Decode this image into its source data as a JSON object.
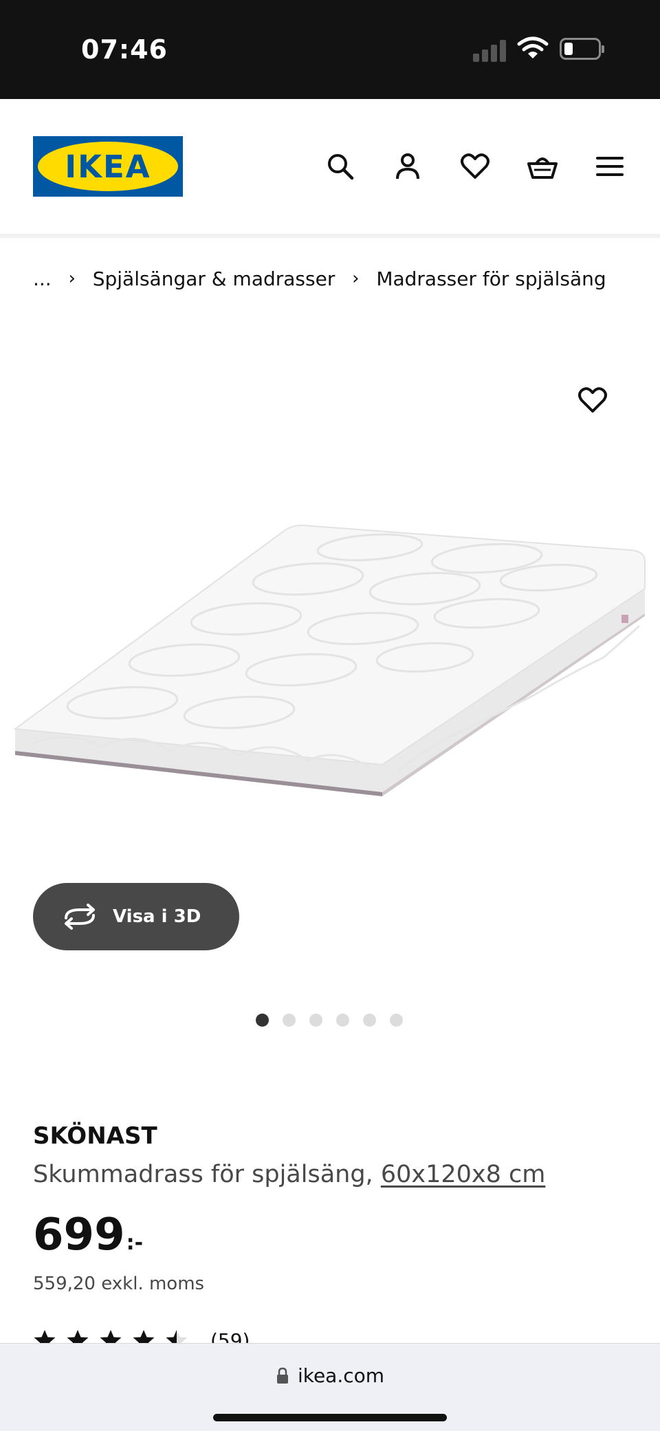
{
  "status_bar": {
    "time": "07:46",
    "icons": [
      "signal-icon",
      "wifi-icon",
      "battery-icon"
    ]
  },
  "header": {
    "logo_text": "IKEA",
    "logo_colors": {
      "blue": "#0058a3",
      "yellow": "#ffdb00"
    },
    "icons": [
      "search-icon",
      "account-icon",
      "heart-icon",
      "basket-icon",
      "menu-icon"
    ]
  },
  "breadcrumb": {
    "items": [
      "...",
      "Spjälsängar & madrasser",
      "Madrasser för spjälsäng"
    ],
    "separator": "›"
  },
  "gallery": {
    "view_3d_label": "Visa i 3D",
    "dots_total": 6,
    "active_dot": 1
  },
  "product": {
    "name": "SKÖNAST",
    "description": "Skummadrass för spjälsäng,",
    "dimensions": "60x120x8 cm",
    "price_integer": "699",
    "price_suffix": ":-",
    "price_excl_vat": "559,20 exkl. moms",
    "rating_value": 4.5,
    "rating_max": 5,
    "review_count": "(59)"
  },
  "browser": {
    "url": "ikea.com"
  }
}
